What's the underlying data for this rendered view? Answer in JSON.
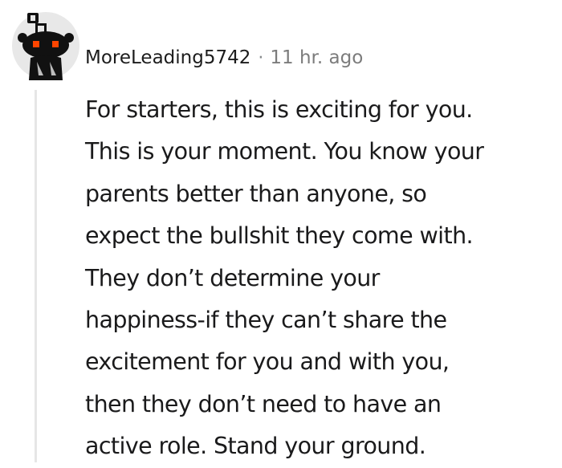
{
  "comment": {
    "username": "MoreLeading5742",
    "separator": "·",
    "timestamp": "11 hr. ago",
    "avatar_icon": "snoo-robot-avatar-icon",
    "body_lines": [
      "For starters, this is exciting for you.",
      "This is your moment. You know your",
      "parents better than anyone, so",
      "expect the bullshit they come with.",
      "They don’t determine your",
      "happiness-if they can’t share the",
      "excitement for you and with you,",
      "then they don’t need to have an",
      "active role. Stand your ground."
    ]
  },
  "colors": {
    "text": "#1a1a1b",
    "meta": "#7c7c7c",
    "thread_line": "#e6e6e6",
    "avatar_bg": "#e8e8e8",
    "avatar_eye": "#ff4500"
  }
}
